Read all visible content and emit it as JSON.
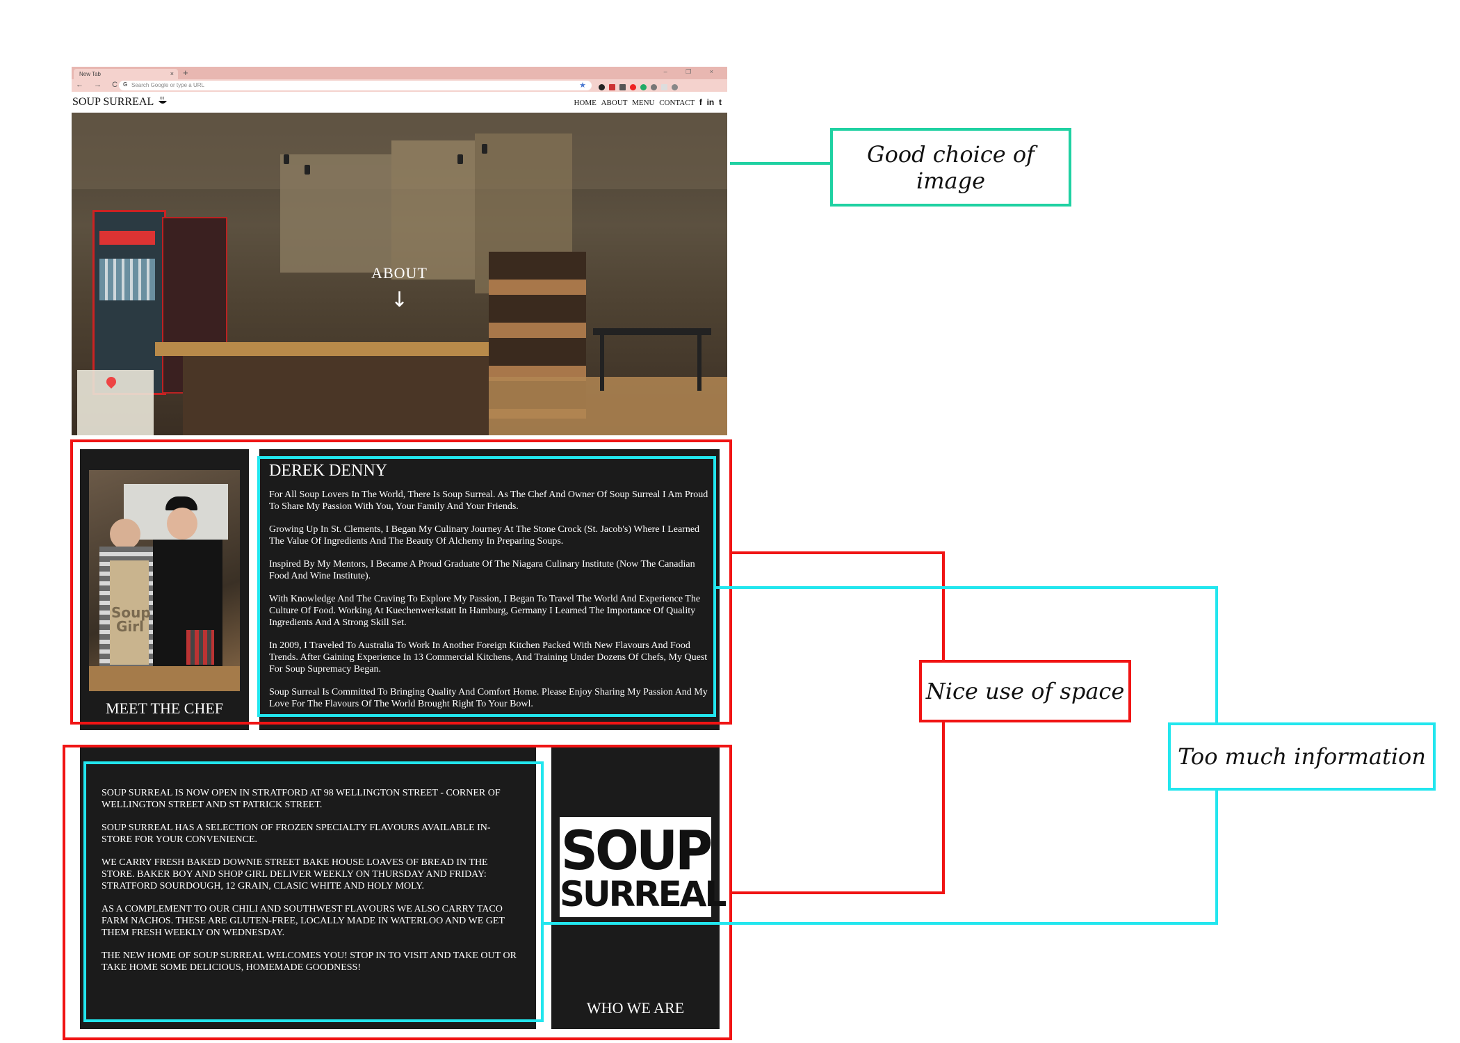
{
  "browser": {
    "tab_title": "New Tab",
    "tab_close": "×",
    "new_tab": "+",
    "window_controls": "– ❐ ×",
    "nav_buttons": "← → C",
    "omnibox_placeholder": "Search Google or type a URL",
    "omnibox_prefix": "G",
    "star": "★"
  },
  "site": {
    "brand": "SOUP SURREAL",
    "nav": [
      "HOME",
      "ABOUT",
      "MENU",
      "CONTACT"
    ],
    "social": [
      "f",
      "in",
      "t"
    ]
  },
  "hero": {
    "label": "ABOUT",
    "arrow": "↓"
  },
  "chef": {
    "section_title": "MEET THE CHEF",
    "name": "DEREK DENNY",
    "paragraphs": [
      "For All Soup Lovers In The World, There Is Soup Surreal. As The Chef And Owner Of Soup Surreal I Am Proud To Share My Passion With You, Your Family And Your Friends.",
      "Growing Up In St. Clements, I Began My Culinary Journey At The Stone Crock (St. Jacob's) Where I Learned The Value Of Ingredients And The Beauty Of Alchemy In Preparing Soups.",
      "Inspired By My Mentors, I Became A Proud Graduate Of The Niagara Culinary Institute (Now The Canadian Food And Wine Institute).",
      "With Knowledge And The Craving To Explore My Passion, I Began To Travel The World And Experience The Culture Of Food. Working At Kuechenwerkstatt In Hamburg, Germany I Learned The Importance Of Quality Ingredients And A Strong Skill Set.",
      "In 2009, I Traveled To Australia To Work In Another Foreign Kitchen Packed With New Flavours And Food Trends. After Gaining Experience In 13 Commercial Kitchens, And Training Under Dozens Of Chefs, My Quest For Soup Supremacy Began.",
      "Soup Surreal Is Committed To Bringing Quality And Comfort Home. Please Enjoy Sharing My Passion And My Love For The Flavours Of The World Brought Right To Your Bowl."
    ],
    "apron_text": "Soup Girl"
  },
  "who": {
    "section_title": "WHO WE ARE",
    "logo_line1": "SOUP",
    "logo_line2": "SURREAL",
    "paragraphs": [
      "SOUP SURREAL IS NOW OPEN IN STRATFORD AT 98 WELLINGTON STREET - CORNER OF WELLINGTON STREET AND ST PATRICK STREET.",
      "SOUP SURREAL HAS A SELECTION OF FROZEN SPECIALTY FLAVOURS AVAILABLE IN-STORE FOR YOUR CONVENIENCE.",
      "WE CARRY FRESH BAKED DOWNIE STREET BAKE HOUSE LOAVES OF BREAD IN THE STORE. BAKER BOY AND SHOP GIRL DELIVER WEEKLY ON THURSDAY AND FRIDAY: STRATFORD SOURDOUGH, 12 GRAIN, CLASIC WHITE AND HOLY MOLY.",
      "AS A COMPLEMENT TO OUR CHILI AND SOUTHWEST FLAVOURS WE ALSO CARRY TACO FARM NACHOS. THESE ARE GLUTEN-FREE, LOCALLY MADE IN WATERLOO AND WE GET THEM FRESH WEEKLY ON WEDNESDAY.",
      "THE NEW HOME OF SOUP SURREAL WELCOMES YOU! STOP IN TO VISIT AND TAKE OUT OR TAKE HOME SOME DELICIOUS, HOMEMADE GOODNESS!"
    ]
  },
  "annotations": {
    "image": "Good choice of image",
    "space": "Nice use of space",
    "info": "Too much information"
  },
  "colors": {
    "annotation_green": "#1fd1a2",
    "annotation_red": "#f01414",
    "annotation_cyan": "#22e6ee",
    "panel_dark": "#1b1b1b"
  }
}
